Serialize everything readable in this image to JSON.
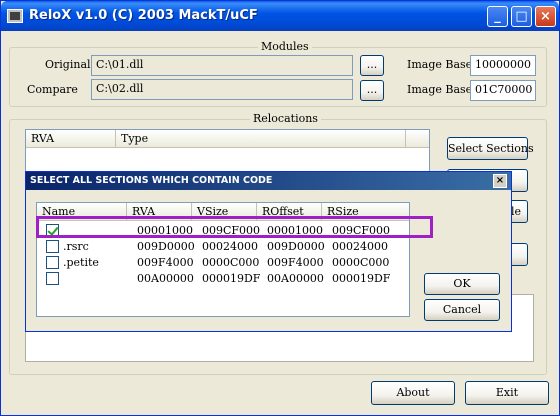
{
  "window": {
    "title": "ReloX v1.0 (C) 2003 MackT/uCF",
    "minimize": "_",
    "maximize": "□",
    "close": "×"
  },
  "modules": {
    "group_label": "Modules",
    "original_label": "Original",
    "original_value": "C:\\01.dll",
    "compare_label": "Compare",
    "compare_value": "C:\\02.dll",
    "browse_label": "...",
    "image_base_label": "Image Base",
    "original_image_base": "10000000",
    "compare_image_base": "01C70000"
  },
  "relocations": {
    "group_label": "Relocations",
    "columns": [
      "RVA",
      "Type"
    ],
    "select_sections_button": "Select Sections",
    "partial_button_label": "le"
  },
  "buttons": {
    "about": "About",
    "exit": "Exit"
  },
  "dialog": {
    "title": "SELECT ALL SECTIONS WHICH CONTAIN CODE",
    "close": "×",
    "columns": [
      "Name",
      "RVA",
      "VSize",
      "ROffset",
      "RSize"
    ],
    "rows": [
      {
        "checked": true,
        "name": "",
        "rva": "00001000",
        "vsize": "009CF000",
        "roffset": "00001000",
        "rsize": "009CF000"
      },
      {
        "checked": false,
        "name": ".rsrc",
        "rva": "009D0000",
        "vsize": "00024000",
        "roffset": "009D0000",
        "rsize": "00024000"
      },
      {
        "checked": false,
        "name": ".petite",
        "rva": "009F4000",
        "vsize": "0000C000",
        "roffset": "009F4000",
        "rsize": "0000C000"
      },
      {
        "checked": false,
        "name": "",
        "rva": "00A00000",
        "vsize": "000019DF",
        "roffset": "00A00000",
        "rsize": "000019DF"
      }
    ],
    "ok_button": "OK",
    "cancel_button": "Cancel"
  },
  "colors": {
    "highlight": "#a020c8",
    "titlebar": "#0055e5",
    "dialog_titlebar": "#0a246a"
  }
}
